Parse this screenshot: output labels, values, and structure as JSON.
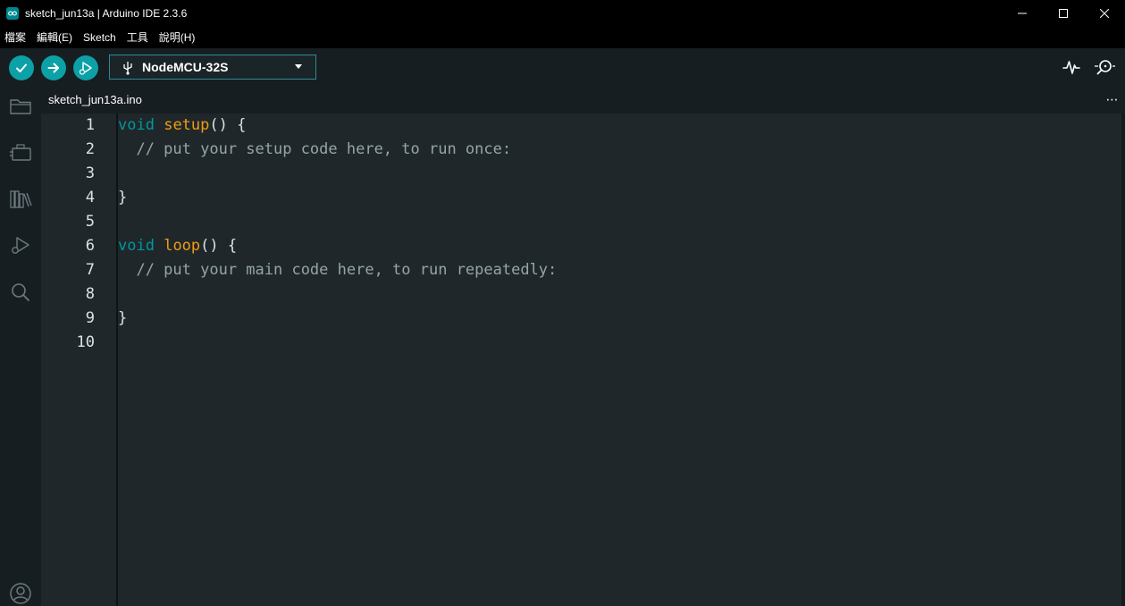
{
  "window": {
    "title": "sketch_jun13a | Arduino IDE 2.3.6",
    "controls": [
      "minimize-icon",
      "maximize-icon",
      "close-icon"
    ]
  },
  "menu": {
    "items": [
      "檔案",
      "編輯(E)",
      "Sketch",
      "工具",
      "說明(H)"
    ]
  },
  "toolbar": {
    "verify_icon": "checkmark-icon",
    "upload_icon": "arrow-right-icon",
    "debug_icon": "debug-icon",
    "board": "NodeMCU-32S",
    "plotter_icon": "serial-plotter-icon",
    "monitor_icon": "serial-monitor-icon"
  },
  "sidebar": {
    "icons": [
      "folder-icon",
      "board-manager-icon",
      "library-icon",
      "debug-icon",
      "search-icon",
      "account-icon"
    ]
  },
  "tabs": [
    {
      "label": "sketch_jun13a.ino"
    }
  ],
  "editor": {
    "line_numbers": [
      "1",
      "2",
      "3",
      "4",
      "5",
      "6",
      "7",
      "8",
      "9",
      "10"
    ],
    "lines": [
      {
        "kw": "void",
        "fn": "setup",
        "rest": "() {"
      },
      {
        "comment": "  // put your setup code here, to run once:"
      },
      {
        "text": ""
      },
      {
        "text": "}"
      },
      {
        "text": ""
      },
      {
        "kw": "void",
        "fn": "loop",
        "rest": "() {"
      },
      {
        "comment": "  // put your main code here, to run repeatedly:"
      },
      {
        "text": ""
      },
      {
        "text": "}"
      },
      {
        "text": ""
      }
    ]
  },
  "colors": {
    "accent": "#0ca1a6",
    "keyword": "#00979c",
    "function": "#f39c12",
    "comment": "#95a5a6"
  }
}
